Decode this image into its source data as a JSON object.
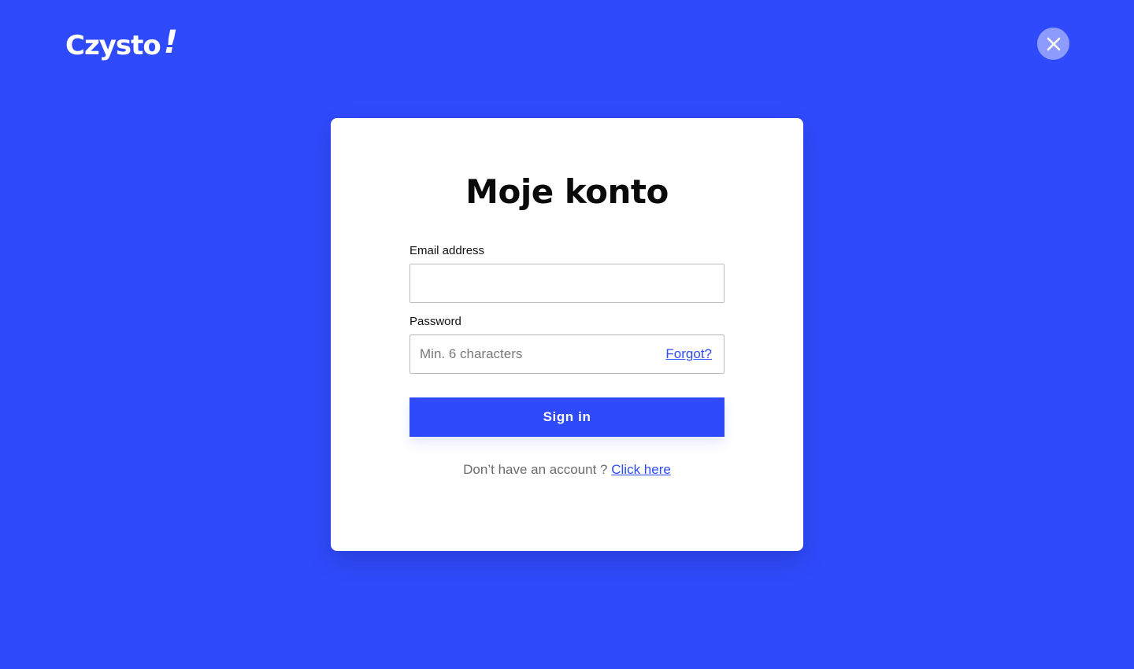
{
  "brand": {
    "name": "Czysto",
    "mark": "!"
  },
  "header": {
    "close_icon": "close-icon"
  },
  "login": {
    "title": "Moje konto",
    "email_label": "Email address",
    "email_value": "",
    "password_label": "Password",
    "password_placeholder": "Min. 6 characters",
    "forgot_link": "Forgot?",
    "submit_label": "Sign in",
    "signup_prompt": "Don’t have an account ?",
    "signup_link": "Click here"
  },
  "colors": {
    "background": "#2f4afb",
    "accent": "#2f4afb",
    "card": "#ffffff"
  }
}
